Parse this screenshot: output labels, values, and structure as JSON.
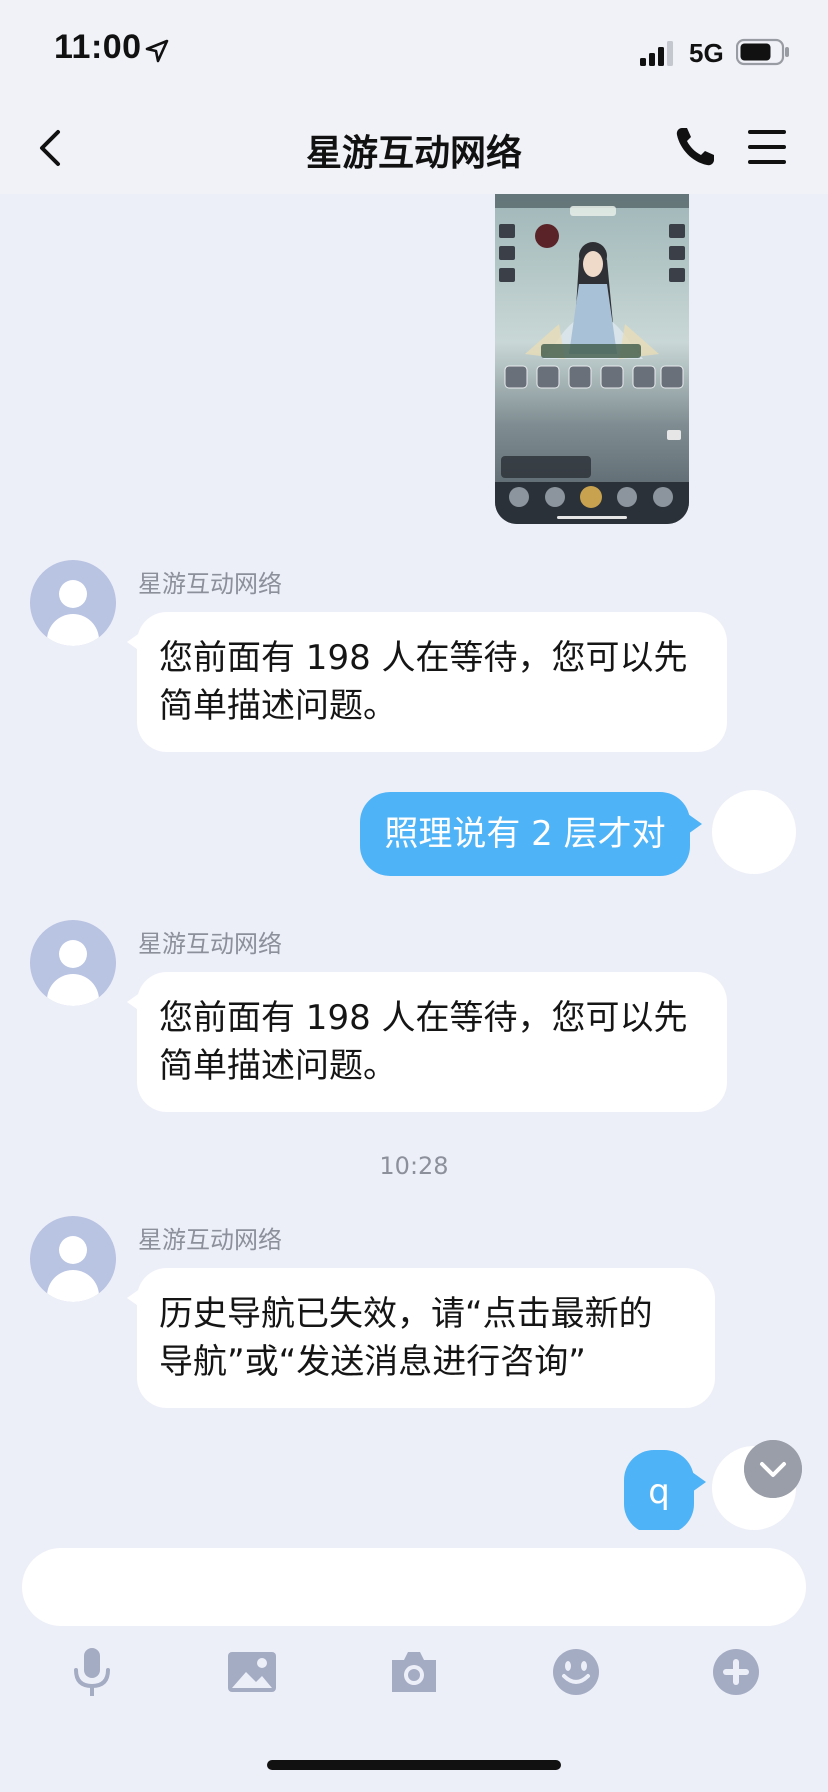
{
  "status_bar": {
    "time": "11:00",
    "network": "5G"
  },
  "header": {
    "title": "星游互动网络"
  },
  "messages": [
    {
      "type": "image",
      "alt": ""
    },
    {
      "type": "incoming",
      "sender": "星游互动网络",
      "lines": [
        "您前面有 198 人在等待，您可以先",
        "简单描述问题。"
      ]
    },
    {
      "type": "outgoing",
      "text": "照理说有 2 层才对"
    },
    {
      "type": "incoming",
      "sender": "星游互动网络",
      "lines": [
        "您前面有 198 人在等待，您可以先",
        "简单描述问题。"
      ]
    },
    {
      "type": "timestamp",
      "text": "10:28"
    },
    {
      "type": "incoming",
      "sender": "星游互动网络",
      "lines": [
        "历史导航已失效，请“点击最新的",
        "导航”或“发送消息进行咨询”"
      ]
    },
    {
      "type": "outgoing",
      "text": "q"
    }
  ],
  "input": {
    "value": "",
    "placeholder": ""
  },
  "toolbar": {
    "icons": [
      "microphone-icon",
      "image-icon",
      "camera-icon",
      "emoji-icon",
      "plus-icon"
    ]
  },
  "colors": {
    "outgoing_bubble": "#4fb3f7",
    "background": "#edeff8",
    "avatar": "#b9c3e2"
  }
}
